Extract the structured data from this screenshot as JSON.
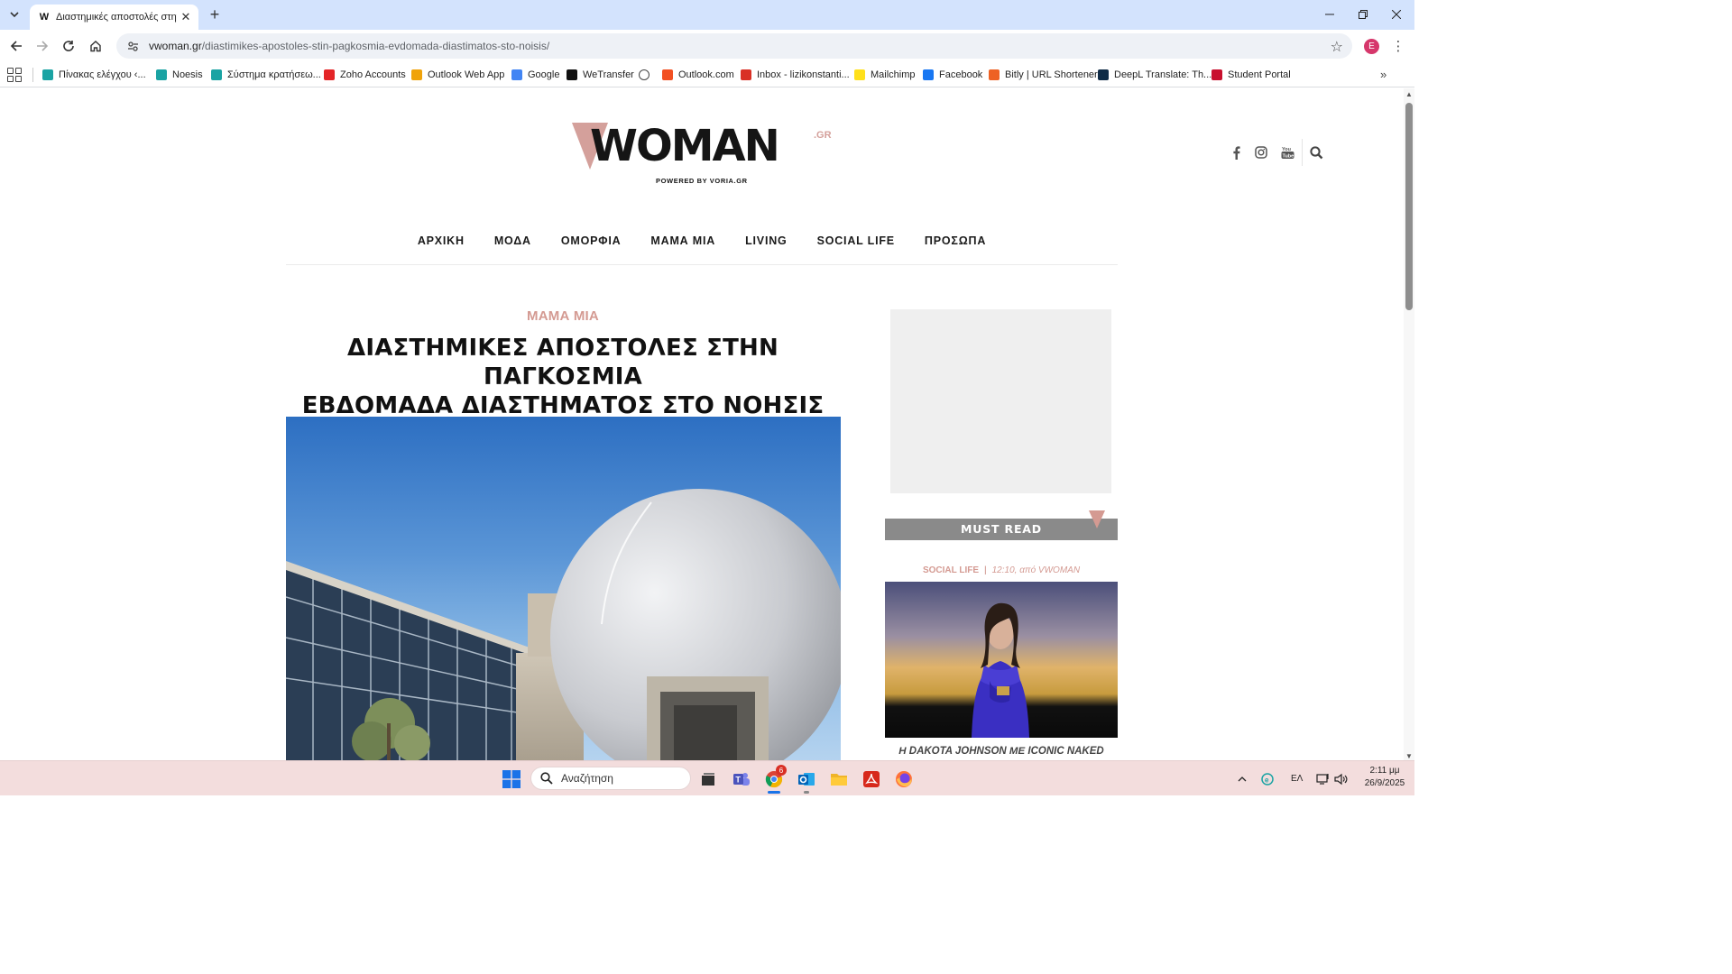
{
  "browser": {
    "tab_title": "Διαστημικές αποστολές στην Π",
    "tab_favicon": "W",
    "url_host": "vwoman.gr",
    "url_path": "/diastimikes-apostoles-stin-pagkosmia-evdomada-diastimatos-sto-noisis/",
    "profile_initial": "E",
    "bookmarks": [
      {
        "label": "Πίνακας ελέγχου ‹...",
        "icon": "dashboard-icon",
        "color": "#1aa3a3"
      },
      {
        "label": "Noesis",
        "icon": "noesis-icon",
        "color": "#1aa3a3"
      },
      {
        "label": "Σύστημα κρατήσεω...",
        "icon": "booking-icon",
        "color": "#1aa3a3"
      },
      {
        "label": "Zoho Accounts",
        "icon": "zoho-icon",
        "color": "#e42527"
      },
      {
        "label": "Outlook Web App",
        "icon": "owa-icon",
        "color": "#f0a30a"
      },
      {
        "label": "Google",
        "icon": "google-icon",
        "color": "#4285f4"
      },
      {
        "label": "WeTransfer",
        "icon": "wetransfer-icon",
        "color": "#111111"
      },
      {
        "label": "",
        "icon": "globe-icon",
        "color": "#444444"
      },
      {
        "label": "Outlook.com",
        "icon": "microsoft-icon",
        "color": "#f25022"
      },
      {
        "label": "Inbox - lizikonstanti...",
        "icon": "gmail-icon",
        "color": "#d93025"
      },
      {
        "label": "Mailchimp",
        "icon": "mailchimp-icon",
        "color": "#ffe01b"
      },
      {
        "label": "Facebook",
        "icon": "facebook-icon",
        "color": "#1877f2"
      },
      {
        "label": "Bitly | URL Shortener",
        "icon": "bitly-icon",
        "color": "#ee6123"
      },
      {
        "label": "DeepL Translate: Th...",
        "icon": "deepl-icon",
        "color": "#0f2b46"
      },
      {
        "label": "Student Portal",
        "icon": "portal-icon",
        "color": "#c8102e"
      }
    ]
  },
  "site": {
    "logo_text": "WOMAN",
    "logo_suffix": ".GR",
    "logo_tagline": "POWERED BY VORIA.GR",
    "nav": [
      "ΑΡΧΙΚΗ",
      "ΜΟΔΑ",
      "ΟΜΟΡΦΙΑ",
      "ΜΑΜΑ ΜΙΑ",
      "LIVING",
      "SOCIAL LIFE",
      "ΠΡΟΣΩΠΑ"
    ],
    "accent_color": "#d49a92"
  },
  "article": {
    "category": "ΜΑΜΑ ΜΙΑ",
    "title_line1": "ΔΙΑΣΤΗΜΙΚΕΣ ΑΠΟΣΤΟΛΕΣ ΣΤΗΝ ΠΑΓΚΟΣΜΙΑ",
    "title_line2": "ΕΒΔΟΜΑΔΑ ΔΙΑΣΤΗΜΑΤΟΣ ΣΤΟ ΝΟΗΣΙΣ"
  },
  "sidebar": {
    "must_read_label": "MUST READ",
    "item_category": "SOCIAL LIFE",
    "item_meta": "12:10, από VWOMAN",
    "item_title": "Η DAKOTA JOHNSON ΜΕ ICONIC NAKED"
  },
  "taskbar": {
    "search_placeholder": "Αναζήτηση",
    "chrome_badge": "6",
    "language": "ΕΛ",
    "time": "2:11 μμ",
    "date": "26/9/2025"
  }
}
